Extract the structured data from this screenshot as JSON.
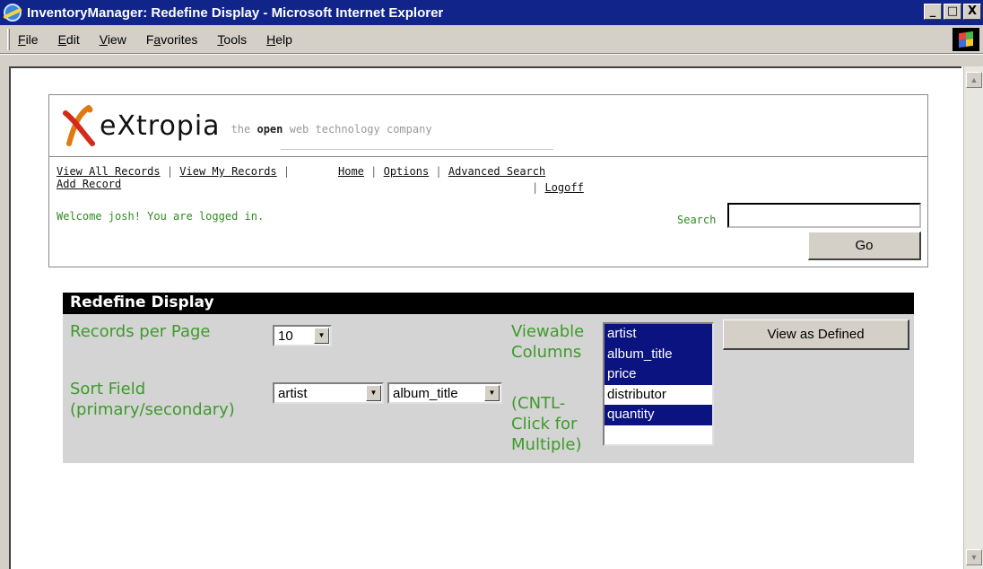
{
  "window": {
    "title": "InventoryManager: Redefine Display - Microsoft Internet Explorer",
    "controls": [
      "_",
      "□",
      "X"
    ]
  },
  "menu": [
    {
      "label": "File",
      "accel": "F",
      "rest": "ile"
    },
    {
      "label": "Edit",
      "accel": "E",
      "rest": "dit"
    },
    {
      "label": "View",
      "accel": "V",
      "rest": "iew"
    },
    {
      "label": "Favorites",
      "accel": "a",
      "pre": "F",
      "rest": "vorites"
    },
    {
      "label": "Tools",
      "accel": "T",
      "rest": "ools"
    },
    {
      "label": "Help",
      "accel": "H",
      "rest": "elp"
    }
  ],
  "logo": {
    "brand": "eXtropia",
    "tagline_pre": "the ",
    "tagline_strong": "open",
    "tagline_post": " web technology company"
  },
  "nav": {
    "view_all": "View All Records",
    "view_mine": "View My Records",
    "add_record": "Add Record",
    "home": "Home",
    "options": "Options",
    "advanced_search": "Advanced Search",
    "logoff": "Logoff",
    "sep": " | "
  },
  "welcome": "Welcome josh! You are logged in.",
  "search": {
    "label": "Search",
    "value": "",
    "go_label": "Go"
  },
  "redefine": {
    "heading": "Redefine Display",
    "records_per_page_label": "Records per Page",
    "records_per_page_value": "10",
    "sort_label": "Sort Field (primary/secondary)",
    "sort_primary": "artist",
    "sort_secondary": "album_title",
    "viewable_label": "Viewable Columns",
    "cntl_hint": "(CNTL-Click for Multiple)",
    "columns": [
      {
        "name": "artist",
        "selected": true
      },
      {
        "name": "album_title",
        "selected": true
      },
      {
        "name": "price",
        "selected": true
      },
      {
        "name": "distributor",
        "selected": false
      },
      {
        "name": "quantity",
        "selected": true
      }
    ],
    "view_button": "View as Defined"
  },
  "colors": {
    "titlebar": "#10248a",
    "green_label": "#3e9a2b",
    "selection": "#0a1380",
    "panel": "#d4d4d4"
  }
}
